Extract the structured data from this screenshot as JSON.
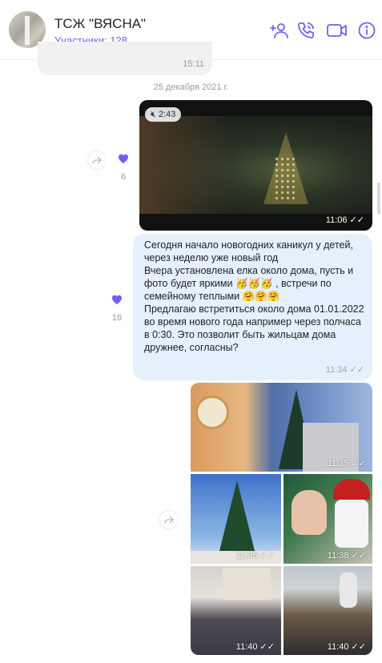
{
  "header": {
    "title": "ТСЖ \"ВЯСНА\"",
    "subtitle": "Участники: 128",
    "icons": [
      "add-participant-icon",
      "call-icon",
      "video-call-icon",
      "info-icon"
    ],
    "accent": "#7360f2"
  },
  "prev_message": {
    "time": "15:11"
  },
  "date_separator": "25 декабря 2021 г.",
  "video_message": {
    "duration": "2:43",
    "time": "11:06",
    "likes": "6"
  },
  "text_message": {
    "text": "Сегодня начало новогодних каникул у детей, через неделю уже новый год\nВчера установлена елка около дома, пусть и фото будет яркими 🥳🥳🥳 , встречи по семейному теплыми 🤗🤗🤗\nПредлагаю встретиться около дома 01.01.2022 во время нового года например через полчаса в 0:30. Это позволит быть жильцам дома дружнее, согласны?",
    "time": "11:34",
    "likes": "16"
  },
  "album": {
    "photos": [
      {
        "time": "11:35"
      },
      {
        "time": "11:35"
      },
      {
        "time": "11:38"
      },
      {
        "time": "11:40"
      },
      {
        "time": "11:40"
      }
    ]
  },
  "colors": {
    "bubble_out": "#e4f1fd",
    "like": "#7360f2"
  }
}
